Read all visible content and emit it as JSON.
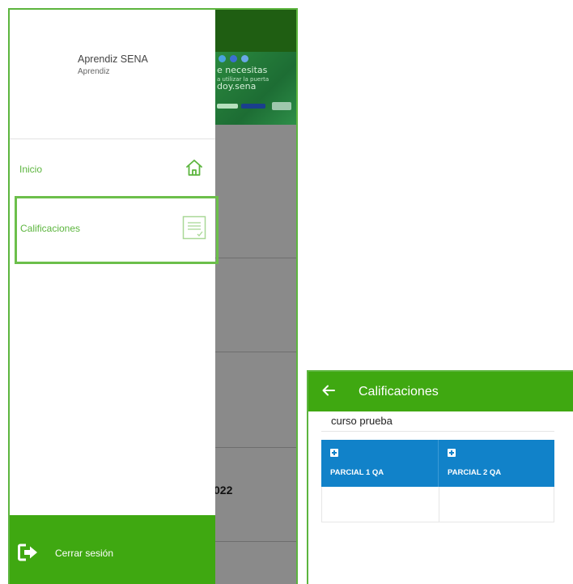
{
  "drawer": {
    "user_name": "Aprendiz SENA",
    "user_role": "Aprendiz",
    "items": [
      {
        "label": "Inicio",
        "icon": "home-icon"
      },
      {
        "label": "Calificaciones",
        "icon": "grades-document-icon"
      }
    ],
    "logout_label": "Cerrar sesión",
    "logout_icon": "logout-icon"
  },
  "background": {
    "banner_line1": "e necesitas",
    "banner_line2": "a utilizar la puerta",
    "banner_line3": "doy.sena",
    "card_year_fragment": "022"
  },
  "grades_screen": {
    "title": "Calificaciones",
    "back_icon": "back-arrow-icon",
    "course_name": "curso prueba",
    "columns": [
      {
        "label": "PARCIAL 1 QA",
        "icon": "expand-plus-icon"
      },
      {
        "label": "PARCIAL 2 QA",
        "icon": "expand-plus-icon"
      }
    ]
  },
  "colors": {
    "brand_green": "#3fa811",
    "accent_green": "#5cb53e",
    "table_blue": "#1182c9"
  }
}
